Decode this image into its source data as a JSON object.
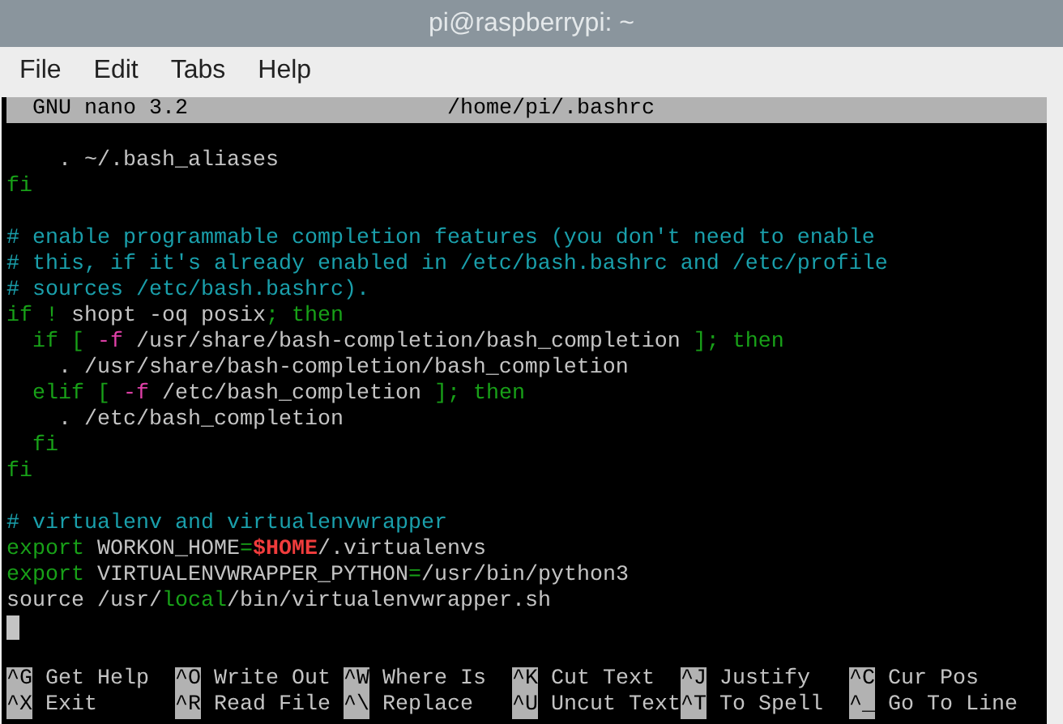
{
  "window": {
    "title": "pi@raspberrypi: ~"
  },
  "menu": [
    "File",
    "Edit",
    "Tabs",
    "Help"
  ],
  "nano": {
    "version": "GNU nano 3.2",
    "filename": "/home/pi/.bashrc"
  },
  "lines": [
    {
      "cursor": false
    },
    {
      "cursor": false,
      "segments": [
        {
          "kind": "text",
          "text": "    . ~/.bash_aliases"
        }
      ]
    },
    {
      "cursor": false,
      "segments": [
        {
          "kind": "keyword",
          "text": "fi"
        }
      ]
    },
    {
      "cursor": false
    },
    {
      "cursor": false,
      "segments": [
        {
          "kind": "comment",
          "text": "# enable programmable completion features (you don't need to enable"
        }
      ]
    },
    {
      "cursor": false,
      "segments": [
        {
          "kind": "comment",
          "text": "# this, if it's already enabled in /etc/bash.bashrc and /etc/profile"
        }
      ]
    },
    {
      "cursor": false,
      "segments": [
        {
          "kind": "comment",
          "text": "# sources /etc/bash.bashrc)."
        }
      ]
    },
    {
      "cursor": false,
      "segments": [
        {
          "kind": "keyword",
          "text": "if !"
        },
        {
          "kind": "text",
          "text": " shopt -oq posix"
        },
        {
          "kind": "keyword",
          "text": "; then"
        }
      ]
    },
    {
      "cursor": false,
      "segments": [
        {
          "kind": "keyword",
          "text": "  if [ "
        },
        {
          "kind": "flag",
          "text": "-f"
        },
        {
          "kind": "text",
          "text": " /usr/share/bash-completion/bash_completion "
        },
        {
          "kind": "keyword",
          "text": "]; then"
        }
      ]
    },
    {
      "cursor": false,
      "segments": [
        {
          "kind": "text",
          "text": "    . /usr/share/bash-completion/bash_completion"
        }
      ]
    },
    {
      "cursor": false,
      "segments": [
        {
          "kind": "keyword",
          "text": "  elif [ "
        },
        {
          "kind": "flag",
          "text": "-f"
        },
        {
          "kind": "text",
          "text": " /etc/bash_completion "
        },
        {
          "kind": "keyword",
          "text": "]; then"
        }
      ]
    },
    {
      "cursor": false,
      "segments": [
        {
          "kind": "text",
          "text": "    . /etc/bash_completion"
        }
      ]
    },
    {
      "cursor": false,
      "segments": [
        {
          "kind": "keyword",
          "text": "  fi"
        }
      ]
    },
    {
      "cursor": false,
      "segments": [
        {
          "kind": "keyword",
          "text": "fi"
        }
      ]
    },
    {
      "cursor": false
    },
    {
      "cursor": false,
      "segments": [
        {
          "kind": "comment",
          "text": "# virtualenv and virtualenvwrapper"
        }
      ]
    },
    {
      "cursor": false,
      "segments": [
        {
          "kind": "keyword",
          "text": "export"
        },
        {
          "kind": "text",
          "text": " WORKON_HOME"
        },
        {
          "kind": "keyword",
          "text": "="
        },
        {
          "kind": "variable",
          "text": "$HOME"
        },
        {
          "kind": "text",
          "text": "/.virtualenvs"
        }
      ]
    },
    {
      "cursor": false,
      "segments": [
        {
          "kind": "keyword",
          "text": "export"
        },
        {
          "kind": "text",
          "text": " VIRTUALENVWRAPPER_PYTHON"
        },
        {
          "kind": "keyword",
          "text": "="
        },
        {
          "kind": "text",
          "text": "/usr/bin/python3"
        }
      ]
    },
    {
      "cursor": false,
      "segments": [
        {
          "kind": "text",
          "text": "source /usr/"
        },
        {
          "kind": "keyword",
          "text": "local"
        },
        {
          "kind": "text",
          "text": "/bin/virtualenvwrapper.sh"
        }
      ]
    },
    {
      "cursor": true
    },
    {
      "cursor": false
    }
  ],
  "shortcuts": [
    {
      "key": "^G",
      "label": "Get Help"
    },
    {
      "key": "^O",
      "label": "Write Out"
    },
    {
      "key": "^W",
      "label": "Where Is"
    },
    {
      "key": "^K",
      "label": "Cut Text"
    },
    {
      "key": "^J",
      "label": "Justify"
    },
    {
      "key": "^C",
      "label": "Cur Pos"
    },
    {
      "key": "^X",
      "label": "Exit"
    },
    {
      "key": "^R",
      "label": "Read File"
    },
    {
      "key": "^\\",
      "label": "Replace"
    },
    {
      "key": "^U",
      "label": "Uncut Text"
    },
    {
      "key": "^T",
      "label": "To Spell"
    },
    {
      "key": "^_",
      "label": "Go To Line"
    }
  ]
}
